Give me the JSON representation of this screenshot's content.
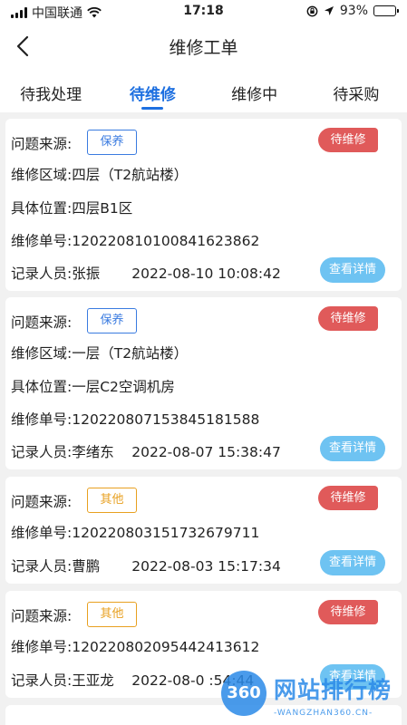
{
  "status_bar": {
    "carrier": "中国联通",
    "time": "17:18",
    "battery": "93%",
    "battery_level": 0.93
  },
  "nav": {
    "title": "维修工单"
  },
  "tabs": [
    {
      "label": "待我处理",
      "active": false
    },
    {
      "label": "待维修",
      "active": true
    },
    {
      "label": "维修中",
      "active": false
    },
    {
      "label": "待采购",
      "active": false
    }
  ],
  "labels": {
    "source": "问题来源:",
    "area": "维修区域:",
    "location": "具体位置:",
    "order_no": "维修单号:",
    "recorder": "记录人员:",
    "detail_button": "查看详情"
  },
  "orders": [
    {
      "source": "保养",
      "source_color": "#3a7be0",
      "status": "待维修",
      "area": "四层（T2航站楼）",
      "location": "四层B1区",
      "order_no": "120220810100841623862",
      "recorder": "张振",
      "time": "2022-08-10 10:08:42"
    },
    {
      "source": "保养",
      "source_color": "#3a7be0",
      "status": "待维修",
      "area": "一层（T2航站楼）",
      "location": "一层C2空调机房",
      "order_no": "120220807153845181588",
      "recorder": "李绪东",
      "time": "2022-08-07 15:38:47"
    },
    {
      "source": "其他",
      "source_color": "#e8a020",
      "status": "待维修",
      "order_no": "120220803151732679711",
      "recorder": "曹鹏",
      "time": "2022-08-03 15:17:34"
    },
    {
      "source": "其他",
      "source_color": "#e8a020",
      "status": "待维修",
      "order_no": "120220802095442413612",
      "recorder": "王亚龙",
      "time": "2022-08-0  :54:44"
    }
  ],
  "watermark": {
    "logo": "360",
    "text": "网站排行榜",
    "url": "-WANGZHAN360.CN-"
  }
}
